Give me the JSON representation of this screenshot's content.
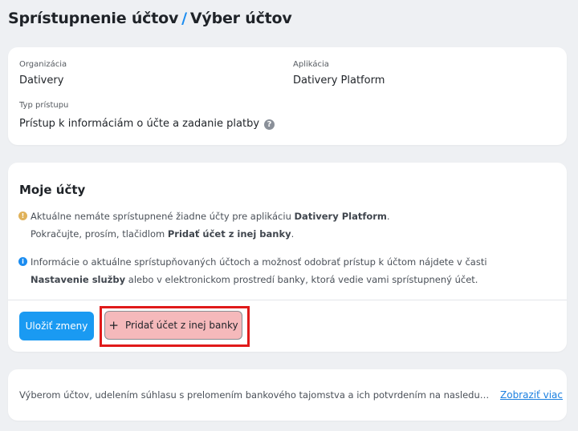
{
  "header": {
    "title_part1": "Sprístupnenie účtov",
    "separator": "/",
    "title_part2": "Výber účtov"
  },
  "details": {
    "organization_label": "Organizácia",
    "organization_value": "Dativery",
    "application_label": "Aplikácia",
    "application_value": "Dativery Platform",
    "access_type_label": "Typ prístupu",
    "access_type_value": "Prístup k informáciám o účte a zadanie platby",
    "help_icon": "question-circle-icon"
  },
  "accounts": {
    "heading": "Moje účty",
    "warning": {
      "icon": "warning-icon",
      "text1": "Aktuálne nemáte sprístupnené žiadne účty pre aplikáciu ",
      "app_name": "Dativery Platform",
      "text2": ".",
      "text3": "Pokračujte, prosím, tlačidlom ",
      "button_ref": "Pridať účet z inej banky",
      "text4": "."
    },
    "info": {
      "icon": "info-icon",
      "text1": "Informácie o aktuálne sprístupňovaných účtoch a možnosť odobrať prístup k účtom nájdete v časti ",
      "settings_ref": "Nastavenie služby",
      "text2": " alebo v elektronickom prostredí banky, ktorá vedie vami sprístupnený účet."
    },
    "save_button": "Uložiť zmeny",
    "add_button": "Pridať účet z inej banky",
    "add_icon": "plus-icon"
  },
  "consent": {
    "text": "Výberom účtov, udelením súhlasu s prelomením bankového tajomstva a ich potvrdením na nasledujúcej obrazovke",
    "more_link": "Zobraziť viac"
  },
  "colors": {
    "primary": "#1a9af2",
    "highlight": "#e01a1a",
    "add_button_bg": "#f5b9bb",
    "warning": "#e0b25a",
    "info": "#1a8cf0"
  }
}
